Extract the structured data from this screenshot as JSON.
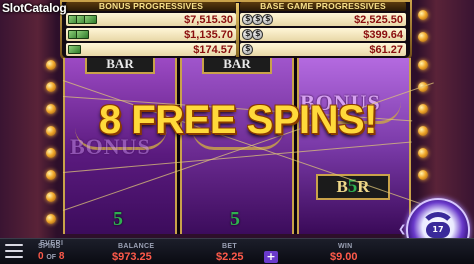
{
  "watermark": "SlotCatalog",
  "progressives": {
    "bonus": {
      "title": "BONUS PROGRESSIVES",
      "values": [
        "$7,515.30",
        "$1,135.70",
        "$174.57"
      ]
    },
    "base": {
      "title": "BASE GAME PROGRESSIVES",
      "values": [
        "$2,525.50",
        "$399.64",
        "$61.27"
      ]
    }
  },
  "reels": {
    "bar_symbol": "BAR",
    "bonus_symbol": "BONUS",
    "b5r_symbol": {
      "b": "B",
      "five": "5",
      "r": "R"
    },
    "green_five": "5"
  },
  "banner": "8 FREE SPINS!",
  "spin_button": {
    "counter": "17",
    "icon": "spin-arrows-icon"
  },
  "bottom_bar": {
    "brand": "EVERI",
    "spins_label": "SPINS",
    "spins_current": "0",
    "spins_of": "OF",
    "spins_total": "8",
    "balance_label": "BALANCE",
    "balance_value": "$973.25",
    "bet_label": "BET",
    "bet_value": "$2.25",
    "plus_label": "+",
    "win_label": "WIN",
    "win_value": "$9.00"
  },
  "colors": {
    "accent_gold": "#ffd93a",
    "value_red": "#ff5a4a",
    "reel_purple": "#7a3aa8"
  }
}
